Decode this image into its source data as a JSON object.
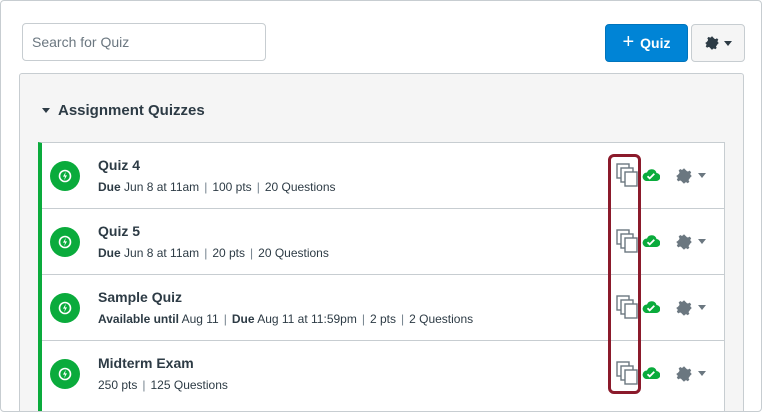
{
  "search": {
    "placeholder": "Search for Quiz"
  },
  "toolbar": {
    "add_quiz_label": "Quiz",
    "add_quiz_icon": "plus-icon",
    "settings_icon": "gear-icon"
  },
  "group": {
    "title": "Assignment Quizzes"
  },
  "colors": {
    "accent": "#0084d6",
    "published": "#0aab3c",
    "highlight": "#8b1a2b"
  },
  "quizzes": [
    {
      "title": "Quiz 4",
      "due_label": "Due",
      "due": "Jun 8 at 11am",
      "points": "100 pts",
      "questions": "20 Questions"
    },
    {
      "title": "Quiz 5",
      "due_label": "Due",
      "due": "Jun 8 at 11am",
      "points": "20 pts",
      "questions": "20 Questions"
    },
    {
      "title": "Sample Quiz",
      "avail_label": "Available until",
      "avail": "Aug 11",
      "due_label": "Due",
      "due": "Aug 11 at 11:59pm",
      "points": "2 pts",
      "questions": "2 Questions"
    },
    {
      "title": "Midterm Exam",
      "points": "250 pts",
      "questions": "125 Questions"
    }
  ]
}
